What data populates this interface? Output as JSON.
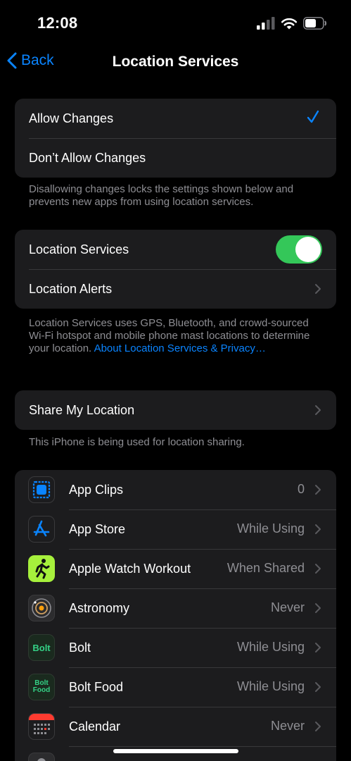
{
  "status_bar": {
    "time": "12:08"
  },
  "nav": {
    "back_label": "Back",
    "title": "Location Services"
  },
  "changes_group": {
    "allow_label": "Allow Changes",
    "dont_allow_label": "Don’t Allow Changes",
    "footer": "Disallowing changes locks the settings shown below and prevents new apps from using location services."
  },
  "location_group": {
    "services_label": "Location Services",
    "services_enabled": true,
    "alerts_label": "Location Alerts",
    "footer_text": "Location Services uses GPS, Bluetooth, and crowd-sourced Wi-Fi hotspot and mobile phone mast locations to determine your location. ",
    "footer_link": "About Location Services & Privacy…"
  },
  "share_group": {
    "share_label": "Share My Location",
    "footer": "This iPhone is being used for location sharing."
  },
  "apps": [
    {
      "name": "App Clips",
      "value": "0",
      "icon": "app-clips-icon"
    },
    {
      "name": "App Store",
      "value": "While Using",
      "icon": "app-store-icon"
    },
    {
      "name": "Apple Watch Workout",
      "value": "When Shared",
      "icon": "workout-icon"
    },
    {
      "name": "Astronomy",
      "value": "Never",
      "icon": "astronomy-icon"
    },
    {
      "name": "Bolt",
      "value": "While Using",
      "icon": "bolt-icon",
      "icon_text": "Bolt"
    },
    {
      "name": "Bolt Food",
      "value": "While Using",
      "icon": "bolt-food-icon",
      "icon_text": "Bolt Food"
    },
    {
      "name": "Calendar",
      "value": "Never",
      "icon": "calendar-icon"
    }
  ],
  "colors": {
    "accent": "#0a84ff",
    "toggle_on": "#34c759",
    "cell_bg": "#1c1c1e",
    "secondary_text": "#8e8e93"
  }
}
